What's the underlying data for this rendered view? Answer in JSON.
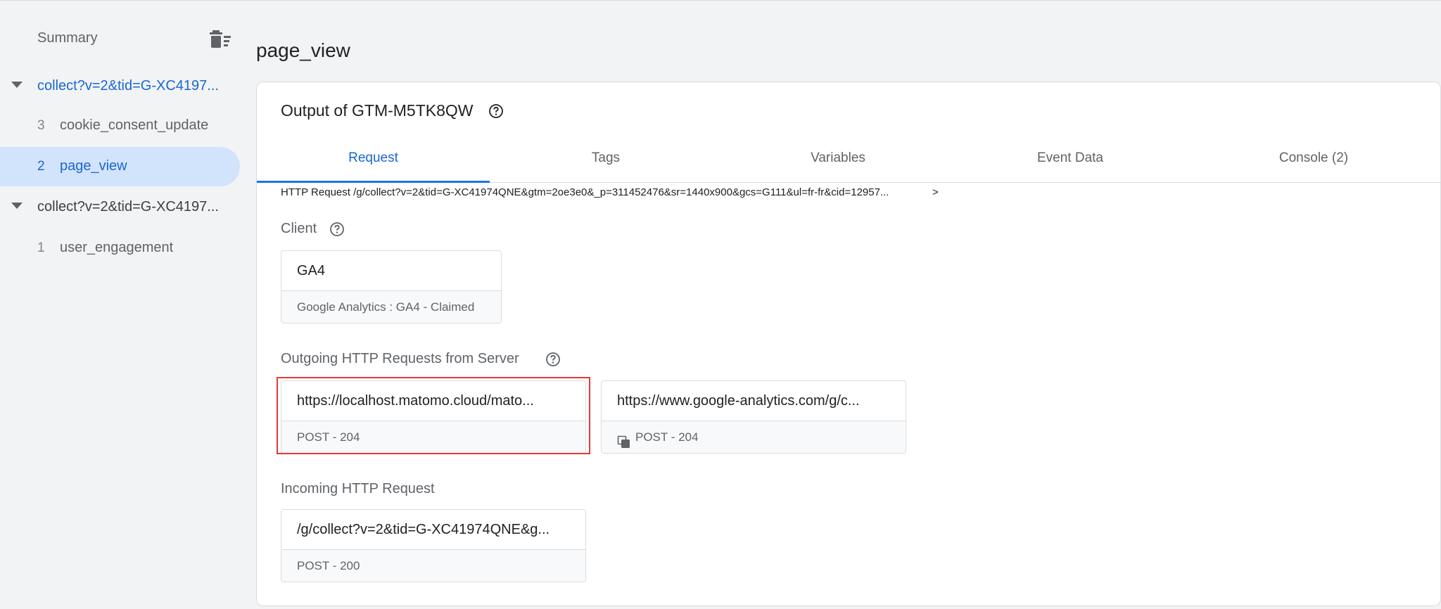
{
  "sidebar": {
    "summary_label": "Summary",
    "groups": [
      {
        "label": "collect?v=2&tid=G-XC4197...",
        "events": [
          {
            "num": "3",
            "label": "cookie_consent_update"
          },
          {
            "num": "2",
            "label": "page_view"
          }
        ]
      },
      {
        "label": "collect?v=2&tid=G-XC4197...",
        "events": [
          {
            "num": "1",
            "label": "user_engagement"
          }
        ]
      }
    ]
  },
  "main": {
    "page_title": "page_view",
    "card_title": "Output of GTM-M5TK8QW",
    "tabs": [
      "Request",
      "Tags",
      "Variables",
      "Event Data",
      "Console (2)"
    ],
    "http_request_line": "HTTP Request /g/collect?v=2&tid=G-XC41974QNE&gtm=2oe3e0&_p=311452476&sr=1440x900&gcs=G111&ul=fr-fr&cid=12957...",
    "http_chevron": ">",
    "client": {
      "label": "Client",
      "name": "GA4",
      "status": "Google Analytics : GA4 - Claimed"
    },
    "outgoing": {
      "label": "Outgoing HTTP Requests from Server",
      "requests": [
        {
          "url": "https://localhost.matomo.cloud/mato...",
          "status": "POST - 204"
        },
        {
          "url": "https://www.google-analytics.com/g/c...",
          "status": "POST - 204"
        }
      ]
    },
    "incoming": {
      "label": "Incoming HTTP Request",
      "url": "/g/collect?v=2&tid=G-XC41974QNE&g...",
      "status": "POST - 200"
    }
  },
  "colors": {
    "accent": "#1a73e8",
    "selected_bg": "#d2e3fc",
    "highlight": "#e53935",
    "background": "#f1f3f4"
  },
  "icons": {
    "clear": "clear-all-icon",
    "help": "help-circle-icon",
    "copy": "copy-icon",
    "caret": "caret-down-icon"
  }
}
